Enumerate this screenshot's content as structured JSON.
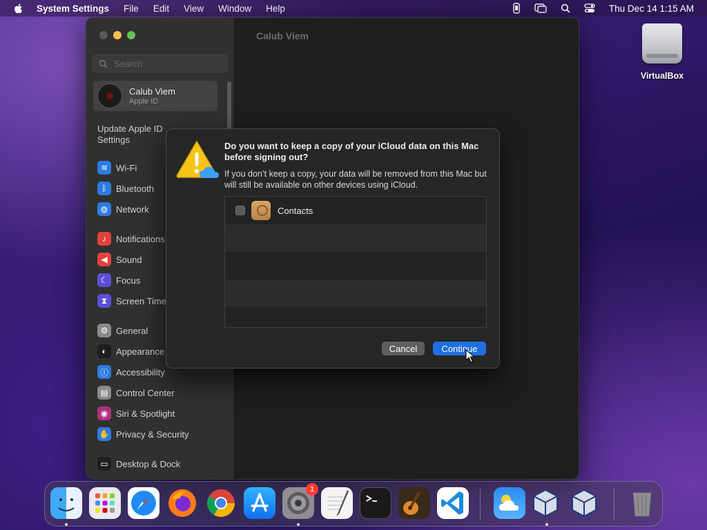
{
  "menubar": {
    "app_name": "System Settings",
    "items": [
      "File",
      "Edit",
      "View",
      "Window",
      "Help"
    ],
    "clock": "Thu Dec 14  1:15 AM"
  },
  "desktop": {
    "icon_label": "VirtualBox"
  },
  "window": {
    "title": "Calub Viem",
    "search_placeholder": "Search",
    "account": {
      "name": "Calub Viem",
      "subtitle": "Apple ID"
    },
    "update_notice": "Update Apple ID Settings",
    "sidebar": [
      {
        "label": "Wi-Fi",
        "icon": "wifi-icon",
        "color": "#2d7be0",
        "glyph": "≋"
      },
      {
        "label": "Bluetooth",
        "icon": "bluetooth-icon",
        "color": "#2d7be0",
        "glyph": "ᛒ"
      },
      {
        "label": "Network",
        "icon": "network-icon",
        "color": "#2d7be0",
        "glyph": "◍"
      },
      {
        "label": "Notifications",
        "icon": "notifications-icon",
        "color": "#e0433d",
        "glyph": "♪"
      },
      {
        "label": "Sound",
        "icon": "sound-icon",
        "color": "#e0433d",
        "glyph": "◀"
      },
      {
        "label": "Focus",
        "icon": "focus-icon",
        "color": "#5b4fd6",
        "glyph": "☾"
      },
      {
        "label": "Screen Time",
        "icon": "screen-time-icon",
        "color": "#5b4fd6",
        "glyph": "⧗"
      },
      {
        "label": "General",
        "icon": "general-icon",
        "color": "#8a8a8a",
        "glyph": "⚙"
      },
      {
        "label": "Appearance",
        "icon": "appearance-icon",
        "color": "#1e1e1e",
        "glyph": "◐"
      },
      {
        "label": "Accessibility",
        "icon": "accessibility-icon",
        "color": "#2d7be0",
        "glyph": "ⓘ"
      },
      {
        "label": "Control Center",
        "icon": "control-center-icon",
        "color": "#8a8a8a",
        "glyph": "▤"
      },
      {
        "label": "Siri & Spotlight",
        "icon": "siri-icon",
        "color": "#b0307e",
        "glyph": "◉"
      },
      {
        "label": "Privacy & Security",
        "icon": "privacy-icon",
        "color": "#2d7be0",
        "glyph": "✋"
      },
      {
        "label": "Desktop & Dock",
        "icon": "desktop-dock-icon",
        "color": "#1e1e1e",
        "glyph": "▭"
      }
    ]
  },
  "dialog": {
    "title": "Do you want to keep a copy of your iCloud data on this Mac before signing out?",
    "message": "If you don’t keep a copy, your data will be removed from this Mac but will still be available on other devices using iCloud.",
    "items": [
      {
        "label": "Contacts",
        "checked": false
      }
    ],
    "cancel_label": "Cancel",
    "continue_label": "Continue"
  },
  "dock": {
    "apps": [
      {
        "name": "finder-icon",
        "running": true
      },
      {
        "name": "launchpad-icon",
        "running": false
      },
      {
        "name": "safari-icon",
        "running": false
      },
      {
        "name": "firefox-icon",
        "running": false
      },
      {
        "name": "chrome-icon",
        "running": false
      },
      {
        "name": "app-store-icon",
        "running": false
      },
      {
        "name": "system-settings-icon",
        "running": true,
        "badge": "1"
      },
      {
        "name": "textedit-icon",
        "running": false
      },
      {
        "name": "terminal-icon",
        "running": false
      },
      {
        "name": "garageband-icon",
        "running": false
      },
      {
        "name": "vscode-icon",
        "running": false
      },
      {
        "name": "weather-icon",
        "running": false
      },
      {
        "name": "virtualbox-icon",
        "running": true
      },
      {
        "name": "virtualbox-2-icon",
        "running": false
      },
      {
        "name": "trash-icon",
        "running": false
      }
    ]
  }
}
